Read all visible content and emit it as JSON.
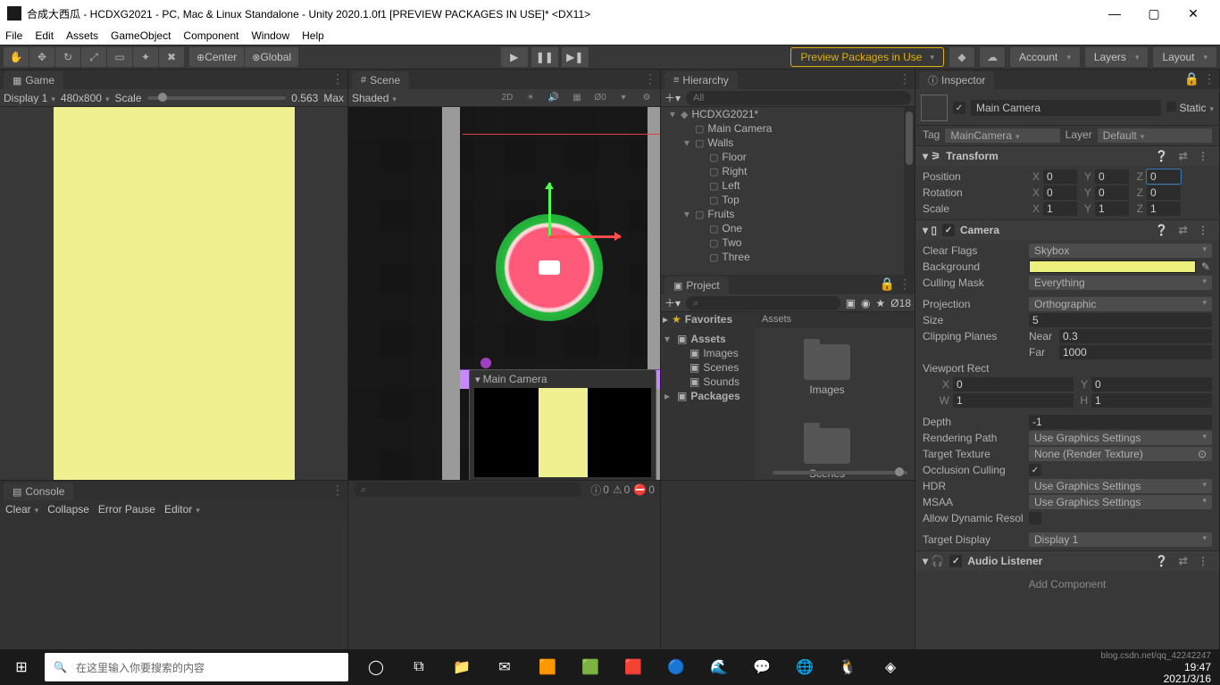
{
  "titlebar": {
    "text": "合成大西瓜 - HCDXG2021 - PC, Mac & Linux Standalone - Unity 2020.1.0f1 [PREVIEW PACKAGES IN USE]* <DX11>"
  },
  "menubar": [
    "File",
    "Edit",
    "Assets",
    "GameObject",
    "Component",
    "Window",
    "Help"
  ],
  "toolbar": {
    "center": "Center",
    "global": "Global",
    "warn": "Preview Packages in Use",
    "account": "Account",
    "layers": "Layers",
    "layout": "Layout"
  },
  "game": {
    "tab": "Game",
    "display": "Display 1",
    "res": "480x800",
    "scaleLabel": "Scale",
    "scaleVal": "0.563",
    "maxLabel": "Max"
  },
  "scene": {
    "tab": "Scene",
    "shaded": "Shaded",
    "twoD": "2D",
    "previewTitle": "Main Camera"
  },
  "hierarchy": {
    "tab": "Hierarchy",
    "search": "All",
    "items": [
      {
        "ind": 0,
        "tw": "▾",
        "icon": "◆",
        "label": "HCDXG2021*"
      },
      {
        "ind": 1,
        "tw": "",
        "icon": "▢",
        "label": "Main Camera"
      },
      {
        "ind": 1,
        "tw": "▾",
        "icon": "▢",
        "label": "Walls"
      },
      {
        "ind": 2,
        "tw": "",
        "icon": "▢",
        "label": "Floor"
      },
      {
        "ind": 2,
        "tw": "",
        "icon": "▢",
        "label": "Right"
      },
      {
        "ind": 2,
        "tw": "",
        "icon": "▢",
        "label": "Left"
      },
      {
        "ind": 2,
        "tw": "",
        "icon": "▢",
        "label": "Top"
      },
      {
        "ind": 1,
        "tw": "▾",
        "icon": "▢",
        "label": "Fruits"
      },
      {
        "ind": 2,
        "tw": "",
        "icon": "▢",
        "label": "One"
      },
      {
        "ind": 2,
        "tw": "",
        "icon": "▢",
        "label": "Two"
      },
      {
        "ind": 2,
        "tw": "",
        "icon": "▢",
        "label": "Three"
      }
    ]
  },
  "project": {
    "tab": "Project",
    "hidden": "18",
    "fav": "Favorites",
    "tree": [
      {
        "ind": 0,
        "tw": "▾",
        "label": "Assets",
        "bold": true
      },
      {
        "ind": 1,
        "tw": "",
        "label": "Images"
      },
      {
        "ind": 1,
        "tw": "",
        "label": "Scenes"
      },
      {
        "ind": 1,
        "tw": "",
        "label": "Sounds"
      },
      {
        "ind": 0,
        "tw": "▸",
        "label": "Packages",
        "bold": true
      }
    ],
    "breadcrumb": "Assets",
    "folders": [
      "Images",
      "Scenes"
    ]
  },
  "console": {
    "tab": "Console",
    "clear": "Clear",
    "collapse": "Collapse",
    "errorPause": "Error Pause",
    "editor": "Editor",
    "counts": {
      "info": "0",
      "warn": "0",
      "err": "0"
    }
  },
  "inspector": {
    "tab": "Inspector",
    "name": "Main Camera",
    "static": "Static",
    "tagLabel": "Tag",
    "tagVal": "MainCamera",
    "layerLabel": "Layer",
    "layerVal": "Default",
    "transform": {
      "title": "Transform",
      "pos": "Position",
      "rot": "Rotation",
      "scale": "Scale",
      "px": "0",
      "py": "0",
      "pz": "0",
      "rx": "0",
      "ry": "0",
      "rz": "0",
      "sx": "1",
      "sy": "1",
      "sz": "1"
    },
    "camera": {
      "title": "Camera",
      "clearFlags": "Clear Flags",
      "clearFlagsV": "Skybox",
      "background": "Background",
      "cullingMask": "Culling Mask",
      "cullingMaskV": "Everything",
      "projection": "Projection",
      "projectionV": "Orthographic",
      "size": "Size",
      "sizeV": "5",
      "clip": "Clipping Planes",
      "near": "Near",
      "nearV": "0.3",
      "far": "Far",
      "farV": "1000",
      "viewport": "Viewport Rect",
      "vx": "0",
      "vy": "0",
      "vw": "1",
      "vh": "1",
      "depth": "Depth",
      "depthV": "-1",
      "rendering": "Rendering Path",
      "renderingV": "Use Graphics Settings",
      "targetTex": "Target Texture",
      "targetTexV": "None (Render Texture)",
      "occlusion": "Occlusion Culling",
      "hdr": "HDR",
      "hdrV": "Use Graphics Settings",
      "msaa": "MSAA",
      "msaaV": "Use Graphics Settings",
      "dynres": "Allow Dynamic Resol",
      "targetDisp": "Target Display",
      "targetDispV": "Display 1"
    },
    "audio": {
      "title": "Audio Listener"
    },
    "addComp": "Add Component"
  },
  "taskbar": {
    "search": "在这里输入你要搜索的内容",
    "time": "19:47",
    "date": "2021/3/16",
    "watermark": "blog.csdn.net/qq_42242247"
  }
}
